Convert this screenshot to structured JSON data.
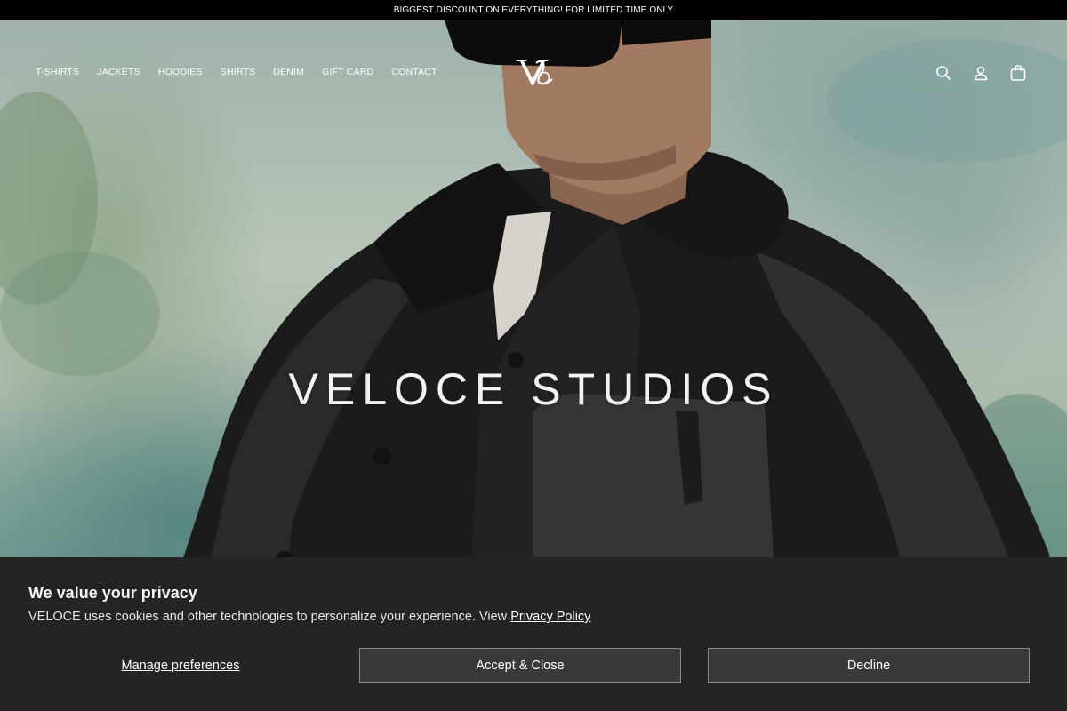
{
  "announcement": {
    "text": "BIGGEST DISCOUNT ON EVERYTHING! FOR LIMITED TIME ONLY"
  },
  "nav": {
    "items": [
      {
        "label": "T-SHIRTS"
      },
      {
        "label": "JACKETS"
      },
      {
        "label": "HOODIES"
      },
      {
        "label": "SHIRTS"
      },
      {
        "label": "DENIM"
      },
      {
        "label": "GIFT CARD"
      },
      {
        "label": "CONTACT"
      }
    ]
  },
  "header": {
    "logo_icon": "veloce-monogram-logo",
    "icons": [
      "search-icon",
      "account-icon",
      "cart-icon"
    ]
  },
  "hero": {
    "title": "VELOCE STUDIOS"
  },
  "cookie_banner": {
    "heading": "We value your privacy",
    "description": "VELOCE uses cookies and other technologies to personalize your experience. View ",
    "policy_link": "Privacy Policy",
    "manage_label": "Manage preferences",
    "accept_label": "Accept & Close",
    "decline_label": "Decline"
  },
  "colors": {
    "announcement_bg": "#000000",
    "banner_bg": "#252424",
    "button_bg": "#3a3939",
    "text": "#ffffff"
  }
}
